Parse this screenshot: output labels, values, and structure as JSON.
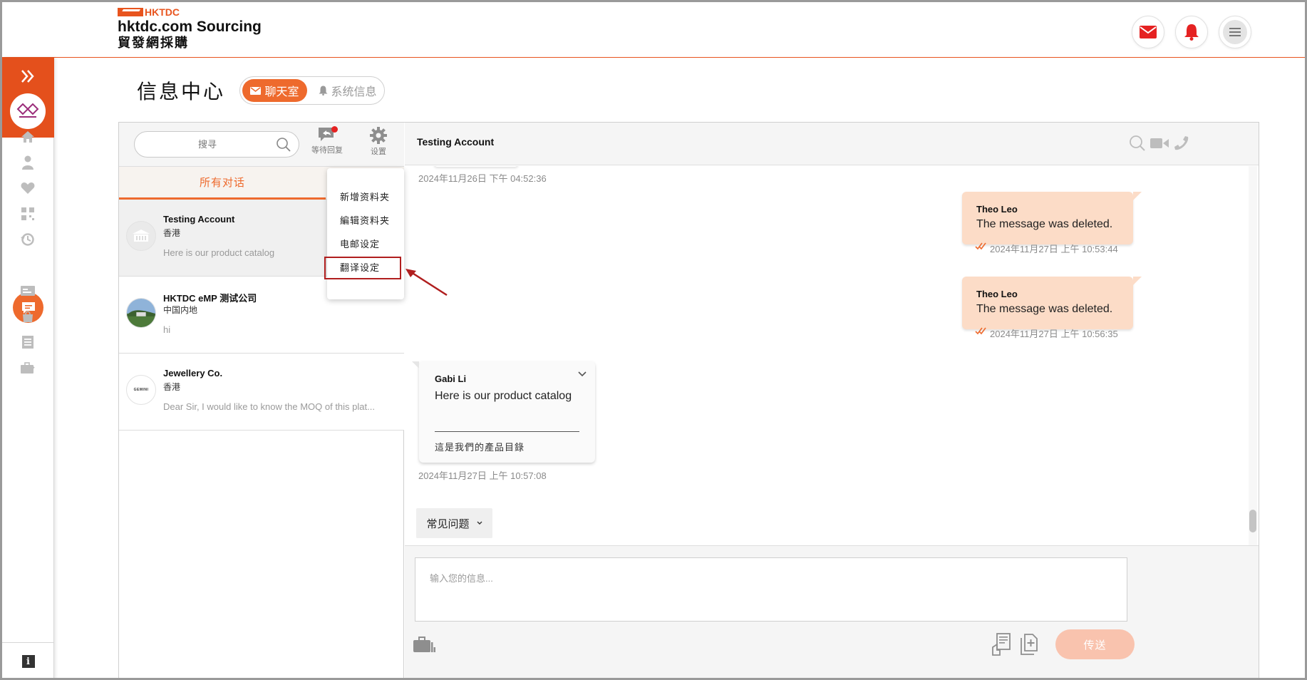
{
  "brand": {
    "mark": "HKTDC",
    "line1": "hktdc.com Sourcing",
    "line2": "貿發網採購"
  },
  "header_icons": [
    "mail-icon",
    "bell-icon",
    "menu-icon"
  ],
  "colors": {
    "accent": "#ee6a2d",
    "brand_red": "#e4501c",
    "bubble_out": "#fcdcc7",
    "send_disabled": "#f9c3ae"
  },
  "page": {
    "title": "信息中心",
    "tabs": [
      {
        "label": "聊天室",
        "active": true
      },
      {
        "label": "系统信息",
        "active": false
      }
    ]
  },
  "sidebar": {
    "items": [
      "home-icon",
      "user-icon",
      "heart-icon",
      "qr-icon",
      "history-icon",
      "chat-icon",
      "card-icon",
      "bag-icon",
      "list-icon",
      "briefcase-icon"
    ],
    "active": "chat-icon",
    "info_label": "i"
  },
  "left_panel": {
    "search_placeholder": "搜寻",
    "waiting_label": "等待回复",
    "settings_label": "设置",
    "filter_tab": "所有对话",
    "conversations": [
      {
        "name": "Testing Account",
        "region": "香港",
        "preview": "Here is our product catalog",
        "selected": true
      },
      {
        "name": "HKTDC eMP 测试公司",
        "region": "中国内地",
        "preview": "hi",
        "selected": false
      },
      {
        "name": "Jewellery Co.",
        "region": "香港",
        "preview": "Dear Sir, I would like to know the MOQ of this plat...",
        "selected": false,
        "avatar_text": "GEMINI"
      }
    ],
    "settings_menu": [
      "新增资料夹",
      "編辑资料夹",
      "电邮设定",
      "翻译设定"
    ],
    "highlighted_menu_item": "翻译设定"
  },
  "chat": {
    "title": "Testing Account",
    "header_icons": [
      "search-icon",
      "video-icon",
      "phone-icon",
      "more-icon"
    ],
    "messages": [
      {
        "type": "timestamp",
        "text": "2024年11月26日 下午 04:52:36"
      },
      {
        "type": "out",
        "sender": "Theo Leo",
        "text": "The message was deleted.",
        "time": "2024年11月27日 上午 10:53:44"
      },
      {
        "type": "out",
        "sender": "Theo Leo",
        "text": "The message was deleted.",
        "time": "2024年11月27日 上午 10:56:35"
      },
      {
        "type": "in",
        "sender": "Gabi Li",
        "text": "Here is our product catalog",
        "translation": "這是我們的產品目錄",
        "time": "2024年11月27日 上午 10:57:08"
      }
    ],
    "faq_label": "常见问题",
    "input_placeholder": "输入您的信息...",
    "send_label": "传送"
  }
}
